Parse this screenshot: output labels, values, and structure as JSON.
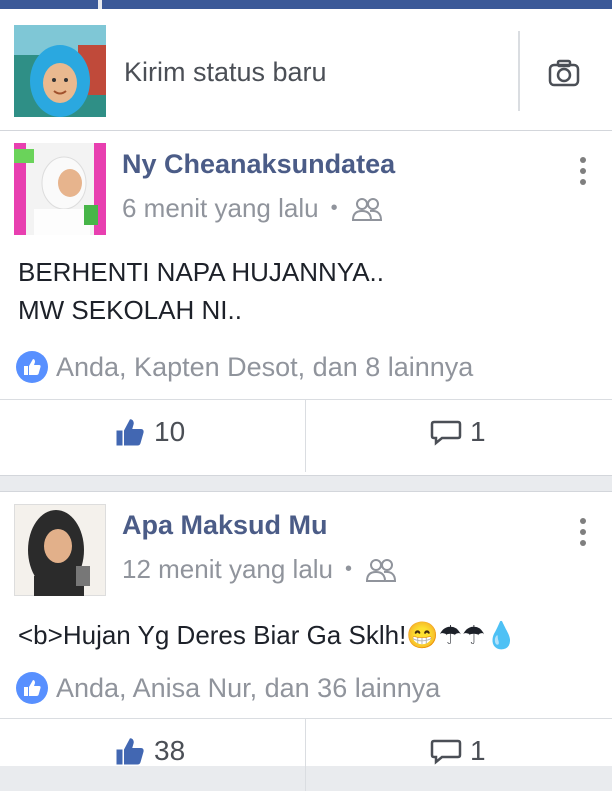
{
  "composer": {
    "placeholder": "Kirim status baru",
    "camera_icon": "camera-icon",
    "avatar_icon": "user-avatar"
  },
  "posts": [
    {
      "author": "Ny Cheanaksundatea",
      "time": "6 menit yang lalu",
      "audience_icon": "friends-icon",
      "body_lines": [
        "BERHENTI NAPA HUJANNYA..",
        "MW SEKOLAH NI.."
      ],
      "likes_summary": "Anda, Kapten Desot, dan 8 lainnya",
      "like_count": "10",
      "comment_count": "1"
    },
    {
      "author": "Apa Maksud Mu",
      "time": "12 menit yang lalu",
      "audience_icon": "friends-icon",
      "body_lines": [
        "<b>Hujan Yg Deres Biar Ga Sklh!😁☂☂💧"
      ],
      "likes_summary": "Anda, Anisa Nur, dan 36 lainnya",
      "like_count": "38",
      "comment_count": "1"
    }
  ],
  "colors": {
    "brand": "#3b5998",
    "name": "#4b5c87",
    "meta": "#90949c",
    "like_blue": "#5890ff"
  }
}
